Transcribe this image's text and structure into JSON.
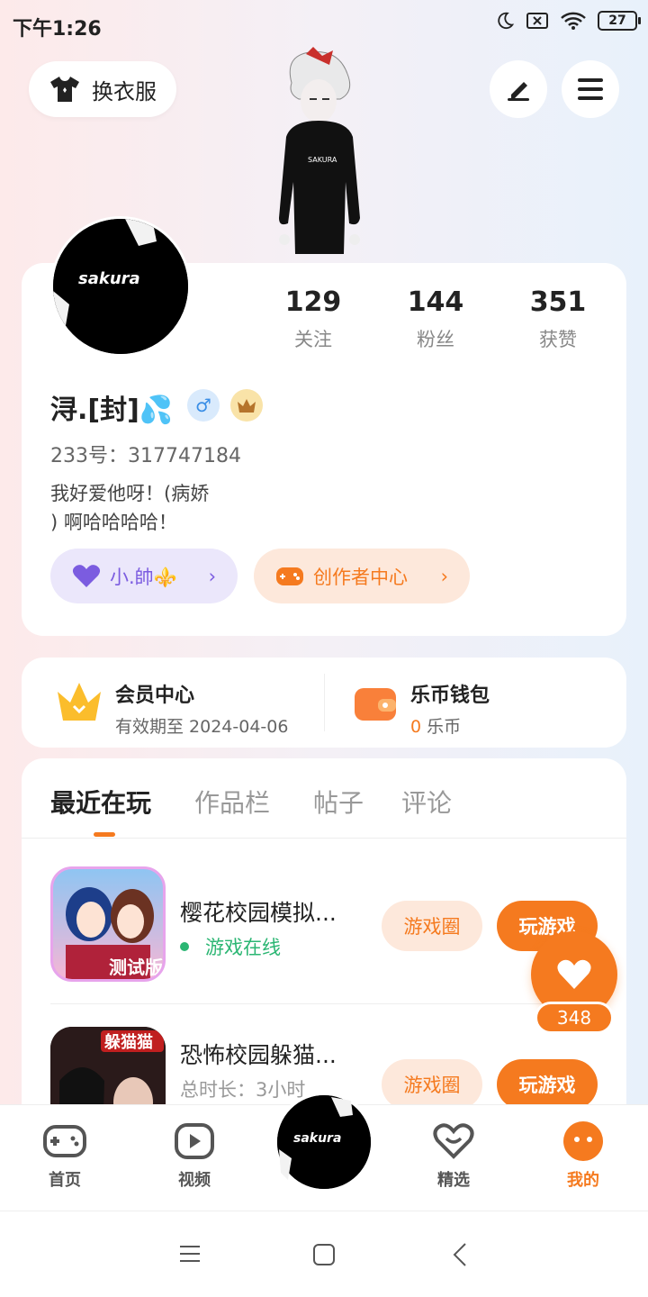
{
  "status_bar": {
    "time": "下午1:26",
    "battery": "27"
  },
  "header": {
    "outfit_label": "换衣服",
    "icons": [
      "shirt-icon",
      "edit-icon",
      "menu-icon"
    ]
  },
  "profile": {
    "stats": [
      {
        "value": "129",
        "label": "关注"
      },
      {
        "value": "144",
        "label": "粉丝"
      },
      {
        "value": "351",
        "label": "获赞"
      }
    ],
    "name": "浔.[封]💦",
    "gender_symbol": "♂",
    "uid": "233号：317747184",
    "bio": "我好爱他呀！(病娇\n) 啊哈哈哈哈！",
    "tag1": "小.帥⚜️",
    "tag2": "创作者中心",
    "avatar_text": "sakura"
  },
  "vip": {
    "title": "会员中心",
    "subtitle": "有效期至 2024-04-06"
  },
  "wallet": {
    "title": "乐币钱包",
    "amount": "0",
    "unit": "乐币"
  },
  "tabs": [
    "最近在玩",
    "作品栏",
    "帖子",
    "评论"
  ],
  "games": [
    {
      "title": "樱花校园模拟...",
      "status": "游戏在线",
      "icon_badge": "测试版",
      "btn1": "游戏圈",
      "btn2": "玩游戏"
    },
    {
      "title": "恐怖校园躲猫...",
      "status": "总时长：3小时",
      "icon_badge": "躲猫猫",
      "btn1": "游戏圈",
      "btn2": "玩游戏"
    }
  ],
  "likes": {
    "count": "348"
  },
  "bottom_nav": [
    {
      "label": "首页",
      "icon": "gamepad-icon"
    },
    {
      "label": "视频",
      "icon": "play-icon"
    },
    {
      "label": "精选",
      "icon": "heart-outline-icon"
    },
    {
      "label": "我的",
      "icon": "face-icon"
    }
  ],
  "colors": {
    "accent": "#f57a1f",
    "online": "#2bb673",
    "purple": "#7b5ce0"
  }
}
